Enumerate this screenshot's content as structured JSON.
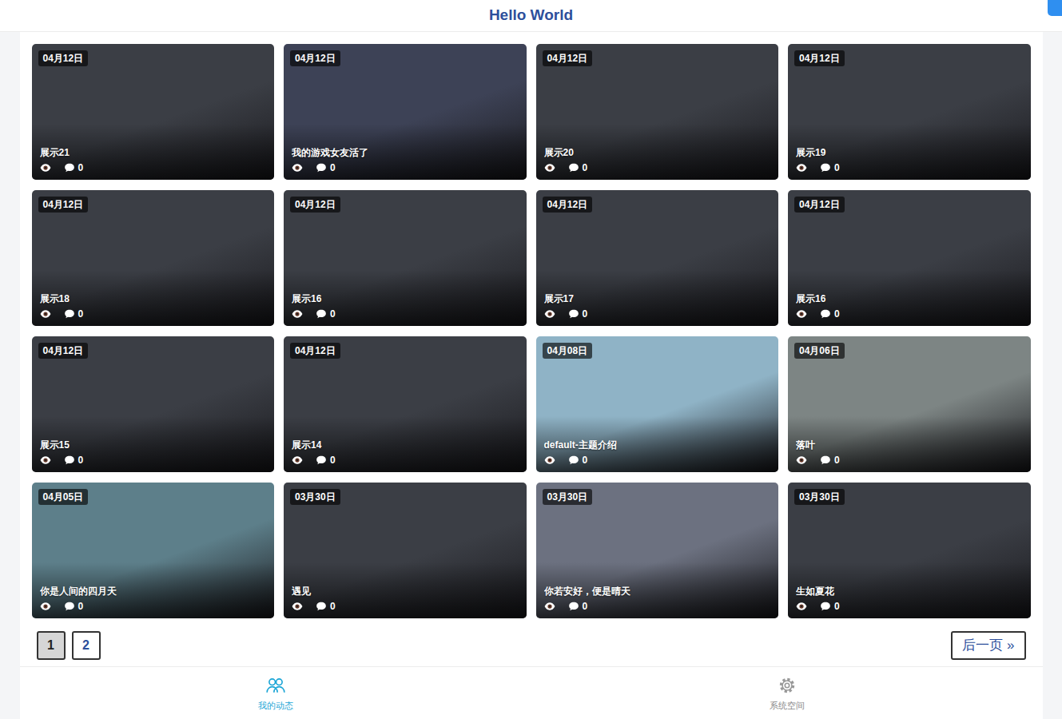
{
  "header": {
    "title": "Hello World"
  },
  "posts": [
    {
      "date": "04月12日",
      "title": "展示21",
      "comments": "0",
      "color": "#3b3e45"
    },
    {
      "date": "04月12日",
      "title": "我的游戏女友活了",
      "comments": "0",
      "color": "#3d4256"
    },
    {
      "date": "04月12日",
      "title": "展示20",
      "comments": "0",
      "color": "#3b3e45"
    },
    {
      "date": "04月12日",
      "title": "展示19",
      "comments": "0",
      "color": "#3b3e45"
    },
    {
      "date": "04月12日",
      "title": "展示18",
      "comments": "0",
      "color": "#3b3e45"
    },
    {
      "date": "04月12日",
      "title": "展示16",
      "comments": "0",
      "color": "#3b3e45"
    },
    {
      "date": "04月12日",
      "title": "展示17",
      "comments": "0",
      "color": "#3b3e45"
    },
    {
      "date": "04月12日",
      "title": "展示16",
      "comments": "0",
      "color": "#3b3e45"
    },
    {
      "date": "04月12日",
      "title": "展示15",
      "comments": "0",
      "color": "#3b3e45"
    },
    {
      "date": "04月12日",
      "title": "展示14",
      "comments": "0",
      "color": "#3b3e45"
    },
    {
      "date": "04月08日",
      "title": "default-主题介绍",
      "comments": "0",
      "color": "#8fb3c6"
    },
    {
      "date": "04月06日",
      "title": "落叶",
      "comments": "0",
      "color": "#7d8584"
    },
    {
      "date": "04月05日",
      "title": "你是人间的四月天",
      "comments": "0",
      "color": "#5d7f8a"
    },
    {
      "date": "03月30日",
      "title": "遇见",
      "comments": "0",
      "color": "#3b3e45"
    },
    {
      "date": "03月30日",
      "title": "你若安好，便是晴天",
      "comments": "0",
      "color": "#6c7180"
    },
    {
      "date": "03月30日",
      "title": "生如夏花",
      "comments": "0",
      "color": "#3b3e45"
    }
  ],
  "pagination": {
    "pages": [
      {
        "label": "1",
        "selected": true
      },
      {
        "label": "2",
        "selected": false
      }
    ],
    "next": "后一页 »"
  },
  "bottom_nav": [
    {
      "label": "我的动态",
      "selected": true
    },
    {
      "label": "系统空间",
      "selected": false
    }
  ]
}
